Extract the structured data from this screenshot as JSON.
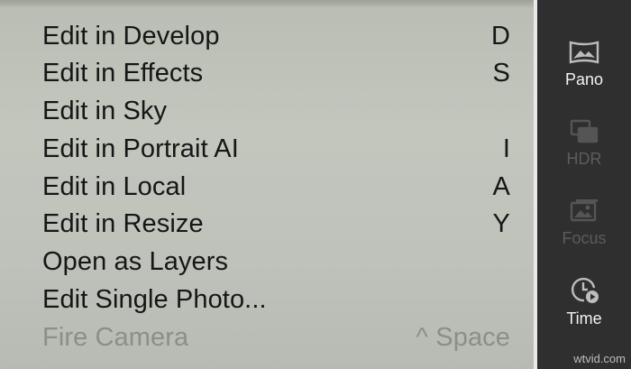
{
  "menu": {
    "items": [
      {
        "label": "Edit in Develop",
        "shortcut": "D"
      },
      {
        "label": "Edit in Effects",
        "shortcut": "S"
      },
      {
        "label": "Edit in Sky",
        "shortcut": ""
      },
      {
        "label": "Edit in Portrait AI",
        "shortcut": "I"
      },
      {
        "label": "Edit in Local",
        "shortcut": "A"
      },
      {
        "label": "Edit in Resize",
        "shortcut": "Y"
      },
      {
        "label": "Open as Layers",
        "shortcut": ""
      },
      {
        "label": "Edit Single Photo...",
        "shortcut": ""
      },
      {
        "label": "Fire Camera",
        "shortcut": "^ Space",
        "disabled": true
      }
    ]
  },
  "sidebar": {
    "tools": [
      {
        "label": "Pano",
        "icon": "panorama-icon",
        "state": "active"
      },
      {
        "label": "HDR",
        "icon": "hdr-stack-icon",
        "state": "disabled"
      },
      {
        "label": "Focus",
        "icon": "focus-stack-icon",
        "state": "disabled"
      },
      {
        "label": "Time",
        "icon": "timelapse-icon",
        "state": "active"
      }
    ]
  },
  "watermark": "wtvid.com",
  "colors": {
    "menu_text": "#161616",
    "menu_disabled": "#8c8f88",
    "sidebar_bg": "#2f2f2f",
    "sidebar_active": "#f2f2f2",
    "sidebar_dim": "#5c5c5c"
  }
}
